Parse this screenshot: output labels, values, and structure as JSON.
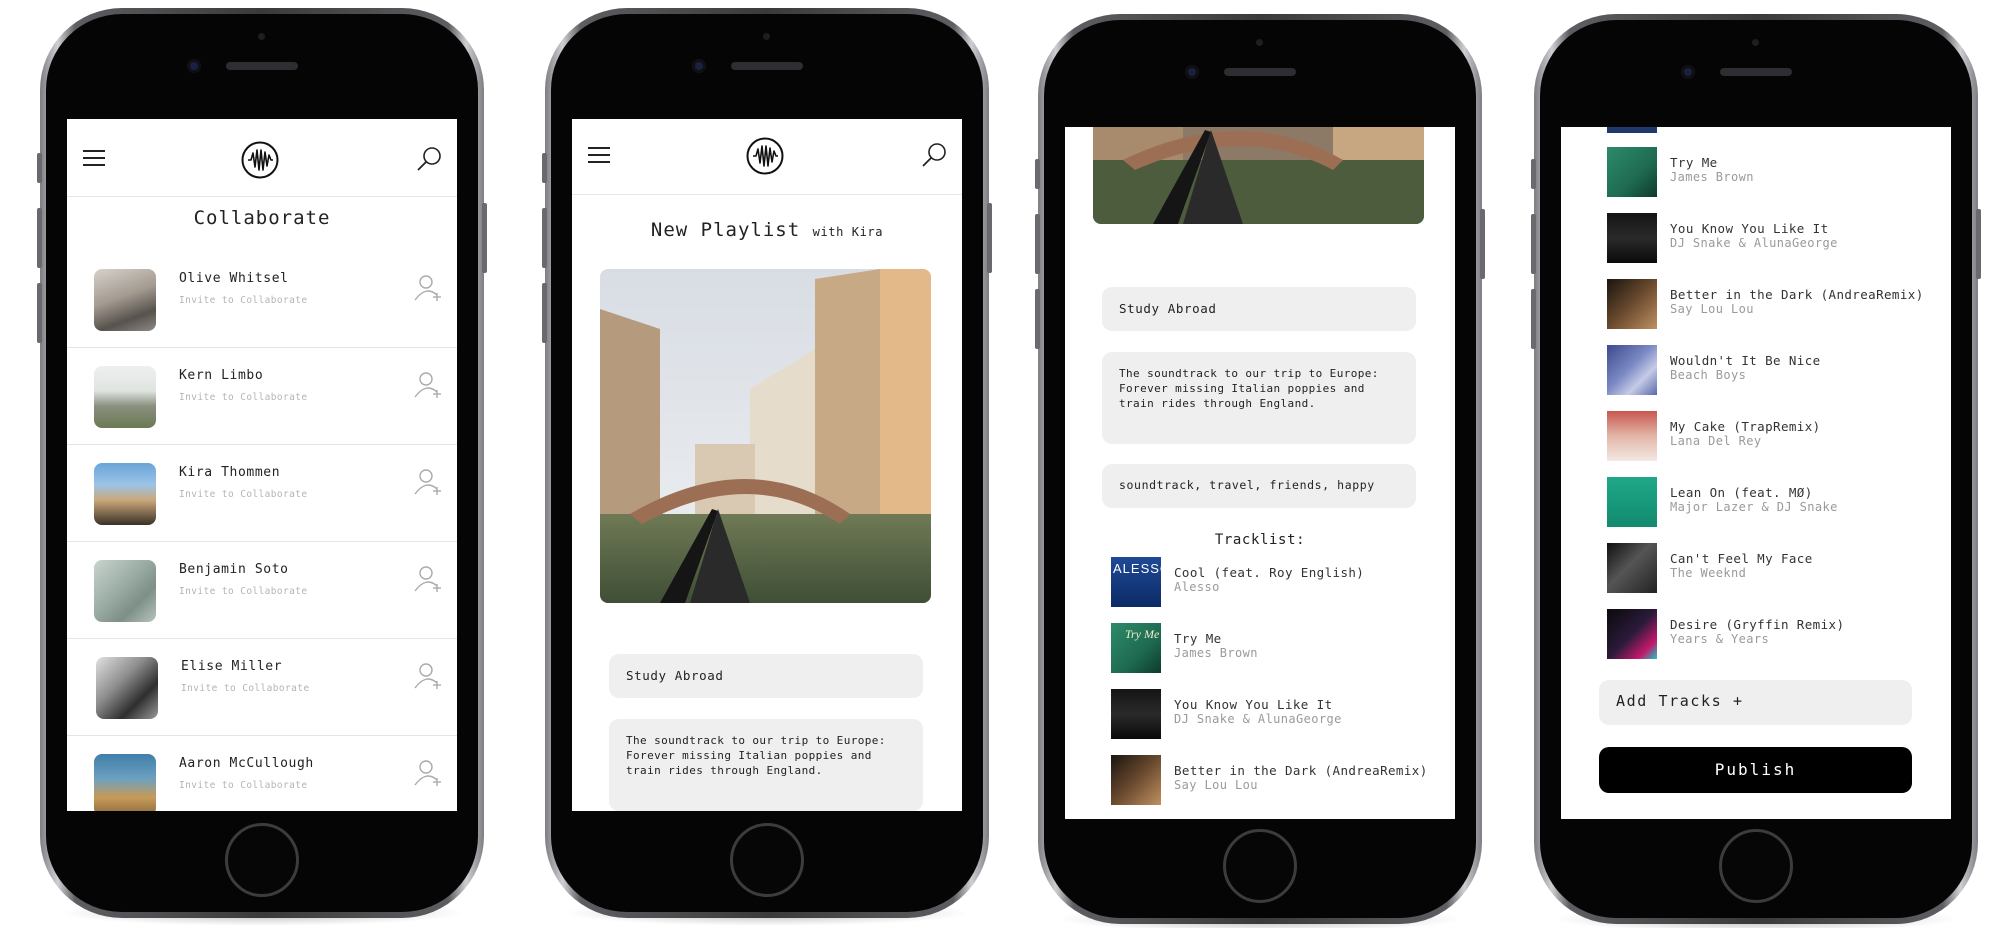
{
  "app": {
    "logo_icon": "soundwave-logo-icon",
    "menu_icon": "hamburger-menu-icon",
    "search_icon": "search-icon"
  },
  "screen1": {
    "title": "Collaborate",
    "contacts": [
      {
        "name": "Olive Whitsel",
        "action": "Invite to Collaborate"
      },
      {
        "name": "Kern Limbo",
        "action": "Invite to Collaborate"
      },
      {
        "name": "Kira Thommen",
        "action": "Invite to Collaborate"
      },
      {
        "name": "Benjamin Soto",
        "action": "Invite to Collaborate"
      },
      {
        "name": "Elise Miller",
        "action": "Invite to Collaborate"
      },
      {
        "name": "Aaron McCullough",
        "action": "Invite to Collaborate"
      }
    ]
  },
  "screen2": {
    "title": "New Playlist",
    "with": "with Kira",
    "playlist_name": "Study Abroad",
    "description": "The soundtrack to our trip to Europe: Forever missing Italian poppies and train rides through England."
  },
  "screen3": {
    "playlist_name": "Study Abroad",
    "description": "The soundtrack to our trip to Europe: Forever missing Italian poppies and train rides through England.",
    "tags": "soundtrack, travel, friends, happy",
    "tracklist_label": "Tracklist:",
    "tracks": [
      {
        "title": "Cool (feat. Roy English)",
        "artist": "Alesso",
        "art_text": "ALESSO"
      },
      {
        "title": "Try Me",
        "artist": "James Brown",
        "art_text": "Try Me"
      },
      {
        "title": "You Know You Like It",
        "artist": "DJ Snake & AlunaGeorge",
        "art_text": ""
      },
      {
        "title": "Better in the Dark (AndreaRemix)",
        "artist": "Say Lou Lou",
        "art_text": ""
      }
    ]
  },
  "screen4": {
    "tracks": [
      {
        "title": "Try Me",
        "artist": "James Brown"
      },
      {
        "title": "You Know You Like It",
        "artist": "DJ Snake & AlunaGeorge"
      },
      {
        "title": "Better in the Dark (AndreaRemix)",
        "artist": "Say Lou Lou"
      },
      {
        "title": "Wouldn't It Be Nice",
        "artist": "Beach Boys"
      },
      {
        "title": "My Cake (TrapRemix)",
        "artist": "Lana Del Rey"
      },
      {
        "title": "Lean On (feat. MØ)",
        "artist": "Major Lazer & DJ Snake"
      },
      {
        "title": "Can't Feel My Face",
        "artist": "The Weeknd"
      },
      {
        "title": "Desire (Gryffin Remix)",
        "artist": "Years & Years"
      }
    ],
    "add_tracks_label": "Add Tracks +",
    "publish_label": "Publish"
  }
}
